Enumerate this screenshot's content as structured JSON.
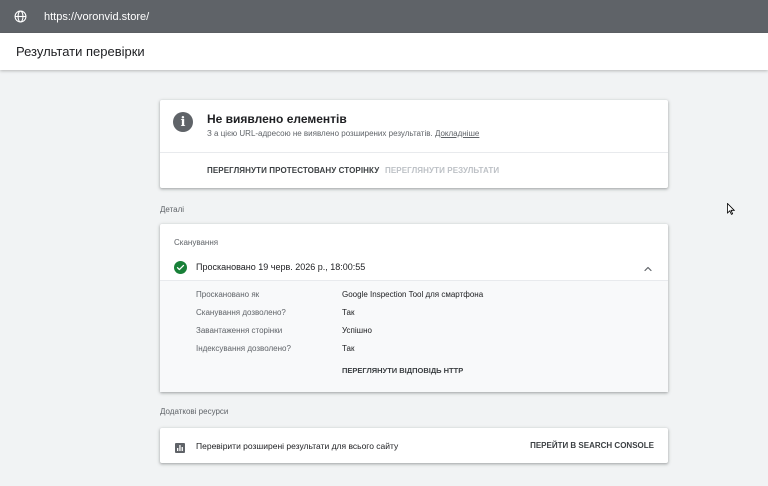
{
  "browser": {
    "url": "https://voronvid.store/",
    "globe_icon": "globe-icon"
  },
  "header": {
    "title": "Результати перевірки"
  },
  "summary": {
    "icon": "info-icon",
    "heading": "Не виявлено елементів",
    "description": "З а цією URL-адресою не виявлено розширених результатів.",
    "more_link": "Докладніше",
    "view_tested_page": "ПЕРЕГЛЯНУТИ ПРОТЕСТОВАНУ СТОРІНКУ",
    "view_results": "ПЕРЕГЛЯНУТИ РЕЗУЛЬТАТИ"
  },
  "details": {
    "section_label": "Деталі",
    "crawl_title": "Сканування",
    "crawled_at": "Проскановано 19 черв. 2026 р., 18:00:55",
    "rows": [
      {
        "label": "Проскановано як",
        "value": "Google Inspection Tool для смартфона"
      },
      {
        "label": "Сканування дозволено?",
        "value": "Так"
      },
      {
        "label": "Завантаження сторінки",
        "value": "Успішно"
      },
      {
        "label": "Індексування дозволено?",
        "value": "Так"
      }
    ],
    "http_button": "ПЕРЕГЛЯНУТИ ВІДПОВІДЬ HTTP"
  },
  "resources": {
    "section_label": "Додаткові ресурси",
    "item_text": "Перевірити розширені результати для всього сайту",
    "item_button": "ПЕРЕЙТИ В SEARCH CONSOLE"
  },
  "colors": {
    "url_bar": "#5f6368",
    "success": "#188038",
    "disabled": "#bdc1c6"
  }
}
